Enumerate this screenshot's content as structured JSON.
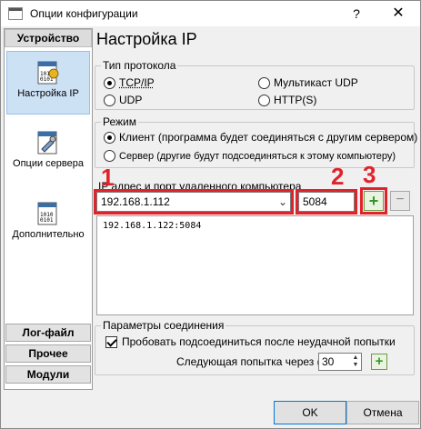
{
  "window": {
    "title": "Опции конфигурации",
    "help_glyph": "?",
    "close_glyph": "✕"
  },
  "nav": {
    "header": "Устройство",
    "items": [
      {
        "label": "Настройка IP",
        "icon": "ip-settings-icon",
        "active": true
      },
      {
        "label": "Опции сервера",
        "icon": "server-options-icon",
        "active": false
      },
      {
        "label": "Дополнительно",
        "icon": "advanced-icon",
        "active": false
      }
    ],
    "footer": [
      "Лог-файл",
      "Прочее",
      "Модули"
    ]
  },
  "page": {
    "title": "Настройка IP",
    "protocol": {
      "legend": "Тип протокола",
      "options": [
        {
          "label": "TCP/IP",
          "selected": true
        },
        {
          "label": "Мультикаст UDP",
          "selected": false
        },
        {
          "label": "UDP",
          "selected": false
        },
        {
          "label": "HTTP(S)",
          "selected": false
        }
      ]
    },
    "mode": {
      "legend": "Режим",
      "options": [
        {
          "label": "Клиент (программа будет соединяться с другим сервером)",
          "selected": true
        },
        {
          "label": "Сервер (другие будут подсоединяться к этому компьютеру)",
          "selected": false
        }
      ]
    },
    "remote": {
      "label": "IP адрес и порт удаленного компьютера",
      "ip_value": "192.168.1.112",
      "port_value": "5084",
      "add_glyph": "+",
      "remove_glyph": "−",
      "list": [
        "192.168.1.122:5084"
      ]
    },
    "annotations": [
      "1",
      "2",
      "3"
    ],
    "connection": {
      "legend": "Параметры соединения",
      "retry_label": "Пробовать подсоединиться после неудачной попытки",
      "retry_checked": true,
      "next_try_label": "Следующая попытка через (с)",
      "next_try_value": "30"
    }
  },
  "buttons": {
    "ok": "OK",
    "cancel": "Отмена"
  },
  "colors": {
    "annotation": "#e0232b",
    "selected_nav": "#cde1f5",
    "add_button": "#2f9b24"
  }
}
